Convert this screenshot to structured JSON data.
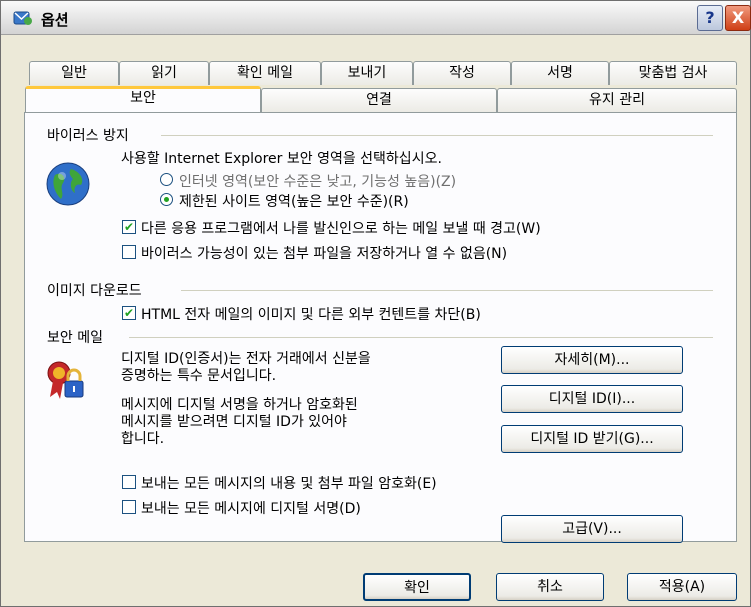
{
  "window": {
    "title": "옵션",
    "help_label": "?",
    "close_label": "X"
  },
  "tabs_row1": [
    "일반",
    "읽기",
    "확인 메일",
    "보내기",
    "작성",
    "서명",
    "맞춤법 검사"
  ],
  "tabs_row2": [
    "보안",
    "연결",
    "유지 관리"
  ],
  "virus": {
    "heading": "바이러스 방지",
    "zone_prompt": "사용할 Internet Explorer 보안 영역을 선택하십시오.",
    "radio_internet": "인터넷 영역(보안 수준은 낮고, 기능성 높음)(Z)",
    "radio_restricted": "제한된 사이트 영역(높은 보안 수준)(R)",
    "warn_send": "다른 응용 프로그램에서 나를 발신인으로 하는 메일 보낼 때 경고(W)",
    "block_attach": "바이러스 가능성이 있는 첨부 파일을 저장하거나 열 수 없음(N)"
  },
  "images": {
    "heading": "이미지 다운로드",
    "block_html": "HTML 전자 메일의 이미지 및 다른 외부 컨텐트를 차단(B)"
  },
  "secure": {
    "heading": "보안 메일",
    "desc1_line1": "디지털 ID(인증서)는 전자 거래에서 신분을",
    "desc1_line2": "증명하는 특수 문서입니다.",
    "desc2_line1": "메시지에 디지털 서명을 하거나 암호화된",
    "desc2_line2": "메시지를 받으려면 디지털 ID가 있어야",
    "desc2_line3": "합니다.",
    "btn_more": "자세히(M)...",
    "btn_ids": "디지털 ID(I)...",
    "btn_get": "디지털 ID 받기(G)...",
    "encrypt_all": "보내는 모든 메시지의 내용 및 첨부 파일 암호화(E)",
    "sign_all": "보내는 모든 메시지에 디지털 서명(D)",
    "btn_advanced": "고급(V)..."
  },
  "footer": {
    "ok": "확인",
    "cancel": "취소",
    "apply": "적용(A)"
  }
}
